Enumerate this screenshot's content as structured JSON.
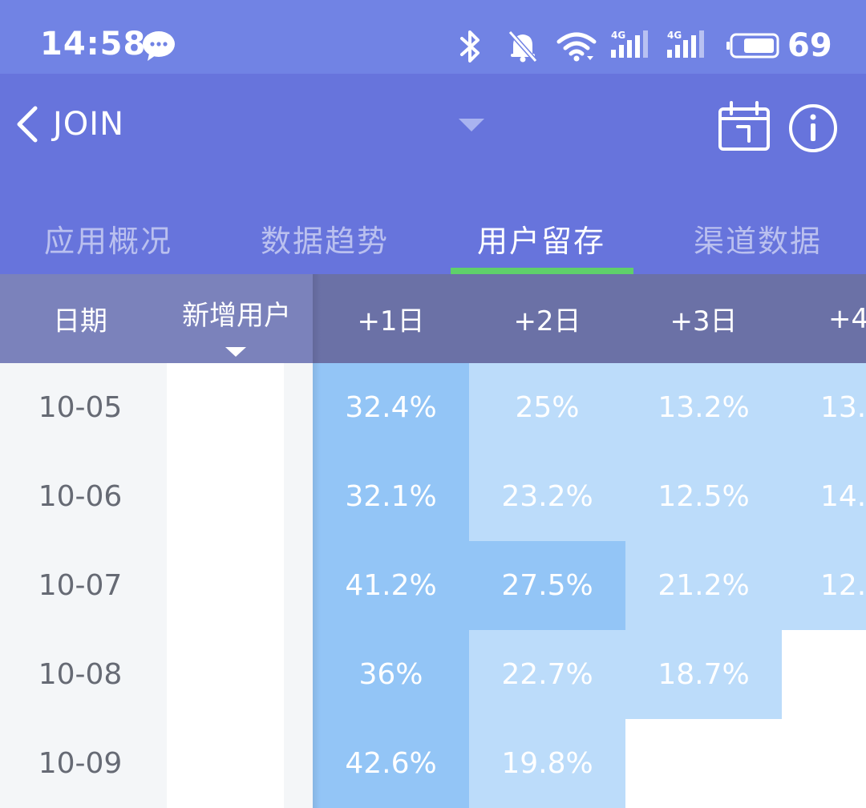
{
  "status_bar": {
    "time": "14:58",
    "battery": "69",
    "icons": [
      "wechat-icon",
      "bluetooth-icon",
      "bell-muted-icon",
      "wifi-icon",
      "signal-4g-icon",
      "signal-4g-icon",
      "battery-icon"
    ]
  },
  "app_bar": {
    "back_icon": "chevron-left-icon",
    "title": "JOIN",
    "dropdown_icon": "caret-down-icon",
    "actions": [
      "calendar-icon",
      "info-icon"
    ]
  },
  "tabs": [
    {
      "label": "应用概况",
      "active": false
    },
    {
      "label": "数据趋势",
      "active": false
    },
    {
      "label": "用户留存",
      "active": true
    },
    {
      "label": "渠道数据",
      "active": false
    }
  ],
  "colors": {
    "status_bar": "#7183e4",
    "app_bar": "#6774dc",
    "tab_indicator": "#5fd06a",
    "header_fixed": "#7b82bb",
    "header_scroll": "#6b71a6",
    "cell_strong": "#93c5f6",
    "cell_light": "#bcdcfa",
    "cell_empty": "#ffffff"
  },
  "table": {
    "headers": {
      "date": "日期",
      "new_users": "新增用户",
      "sort_icon": "caret-down-icon",
      "days": [
        "+1日",
        "+2日",
        "+3日",
        "+4"
      ]
    },
    "rows": [
      {
        "date": "10-05",
        "cells": [
          {
            "text": "32.4%",
            "level": "strong"
          },
          {
            "text": "25%",
            "level": "light"
          },
          {
            "text": "13.2%",
            "level": "light"
          },
          {
            "text": "13.",
            "level": "light"
          }
        ]
      },
      {
        "date": "10-06",
        "cells": [
          {
            "text": "32.1%",
            "level": "strong"
          },
          {
            "text": "23.2%",
            "level": "light"
          },
          {
            "text": "12.5%",
            "level": "light"
          },
          {
            "text": "14.",
            "level": "light"
          }
        ]
      },
      {
        "date": "10-07",
        "cells": [
          {
            "text": "41.2%",
            "level": "strong"
          },
          {
            "text": "27.5%",
            "level": "strong"
          },
          {
            "text": "21.2%",
            "level": "light"
          },
          {
            "text": "12.",
            "level": "light"
          }
        ]
      },
      {
        "date": "10-08",
        "cells": [
          {
            "text": "36%",
            "level": "strong"
          },
          {
            "text": "22.7%",
            "level": "light"
          },
          {
            "text": "18.7%",
            "level": "light"
          },
          {
            "text": "",
            "level": "empty"
          }
        ]
      },
      {
        "date": "10-09",
        "cells": [
          {
            "text": "42.6%",
            "level": "strong"
          },
          {
            "text": "19.8%",
            "level": "light"
          },
          {
            "text": "",
            "level": "empty"
          },
          {
            "text": "",
            "level": "empty"
          }
        ]
      }
    ]
  }
}
